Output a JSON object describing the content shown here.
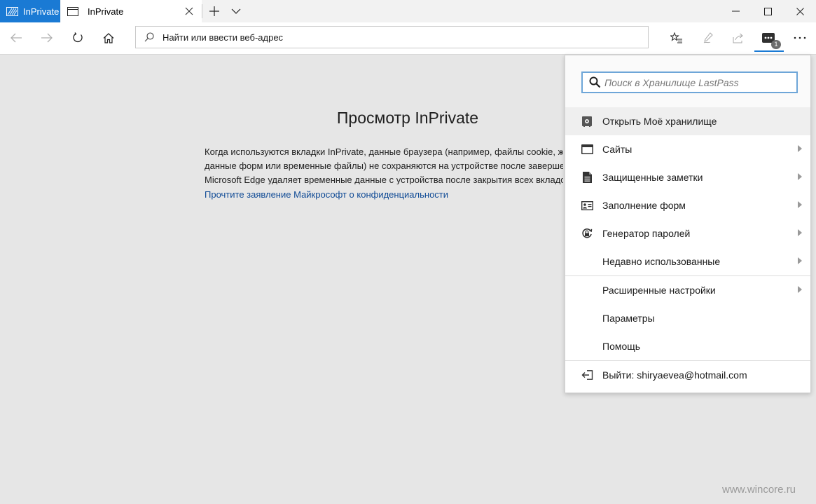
{
  "titlebar": {
    "inprivate_badge": "InPrivate",
    "tab_title": "InPrivate"
  },
  "navbar": {
    "address_placeholder": "Найти или ввести веб-адрес",
    "lastpass_badge_count": "1"
  },
  "page": {
    "title": "Просмотр InPrivate",
    "text_lines": [
      "Когда используются вкладки InPrivate, данные браузера (например, файлы cookie, журнал,",
      "данные форм или временные файлы) не сохраняются на устройстве после завершения сеанса.",
      "Microsoft Edge удаляет временные данные с устройства после закрытия всех вкладок InPrivate."
    ],
    "privacy_link": "Прочтите заявление Майкрософт о конфиденциальности",
    "watermark": "www.wincore.ru"
  },
  "lastpass": {
    "search_placeholder": "Поиск в Хранилище LastPass",
    "items": [
      {
        "label": "Открыть Моё хранилище",
        "icon": "vault-icon"
      },
      {
        "label": "Сайты",
        "icon": "sites-icon",
        "arrow": true
      },
      {
        "label": "Защищенные заметки",
        "icon": "secure-notes-icon",
        "arrow": true
      },
      {
        "label": "Заполнение форм",
        "icon": "form-fill-icon",
        "arrow": true
      },
      {
        "label": "Генератор паролей",
        "icon": "password-generator-icon",
        "arrow": true
      },
      {
        "label": "Недавно использованные",
        "arrow": true
      }
    ],
    "settings_items": [
      {
        "label": "Расширенные настройки",
        "arrow": true
      },
      {
        "label": "Параметры"
      },
      {
        "label": "Помощь"
      }
    ],
    "logout_label": "Выйти: shiryaevea@hotmail.com"
  },
  "colors": {
    "accent": "#1a7ad4",
    "page_bg": "#e6e6e6",
    "link": "#0f4a95"
  }
}
